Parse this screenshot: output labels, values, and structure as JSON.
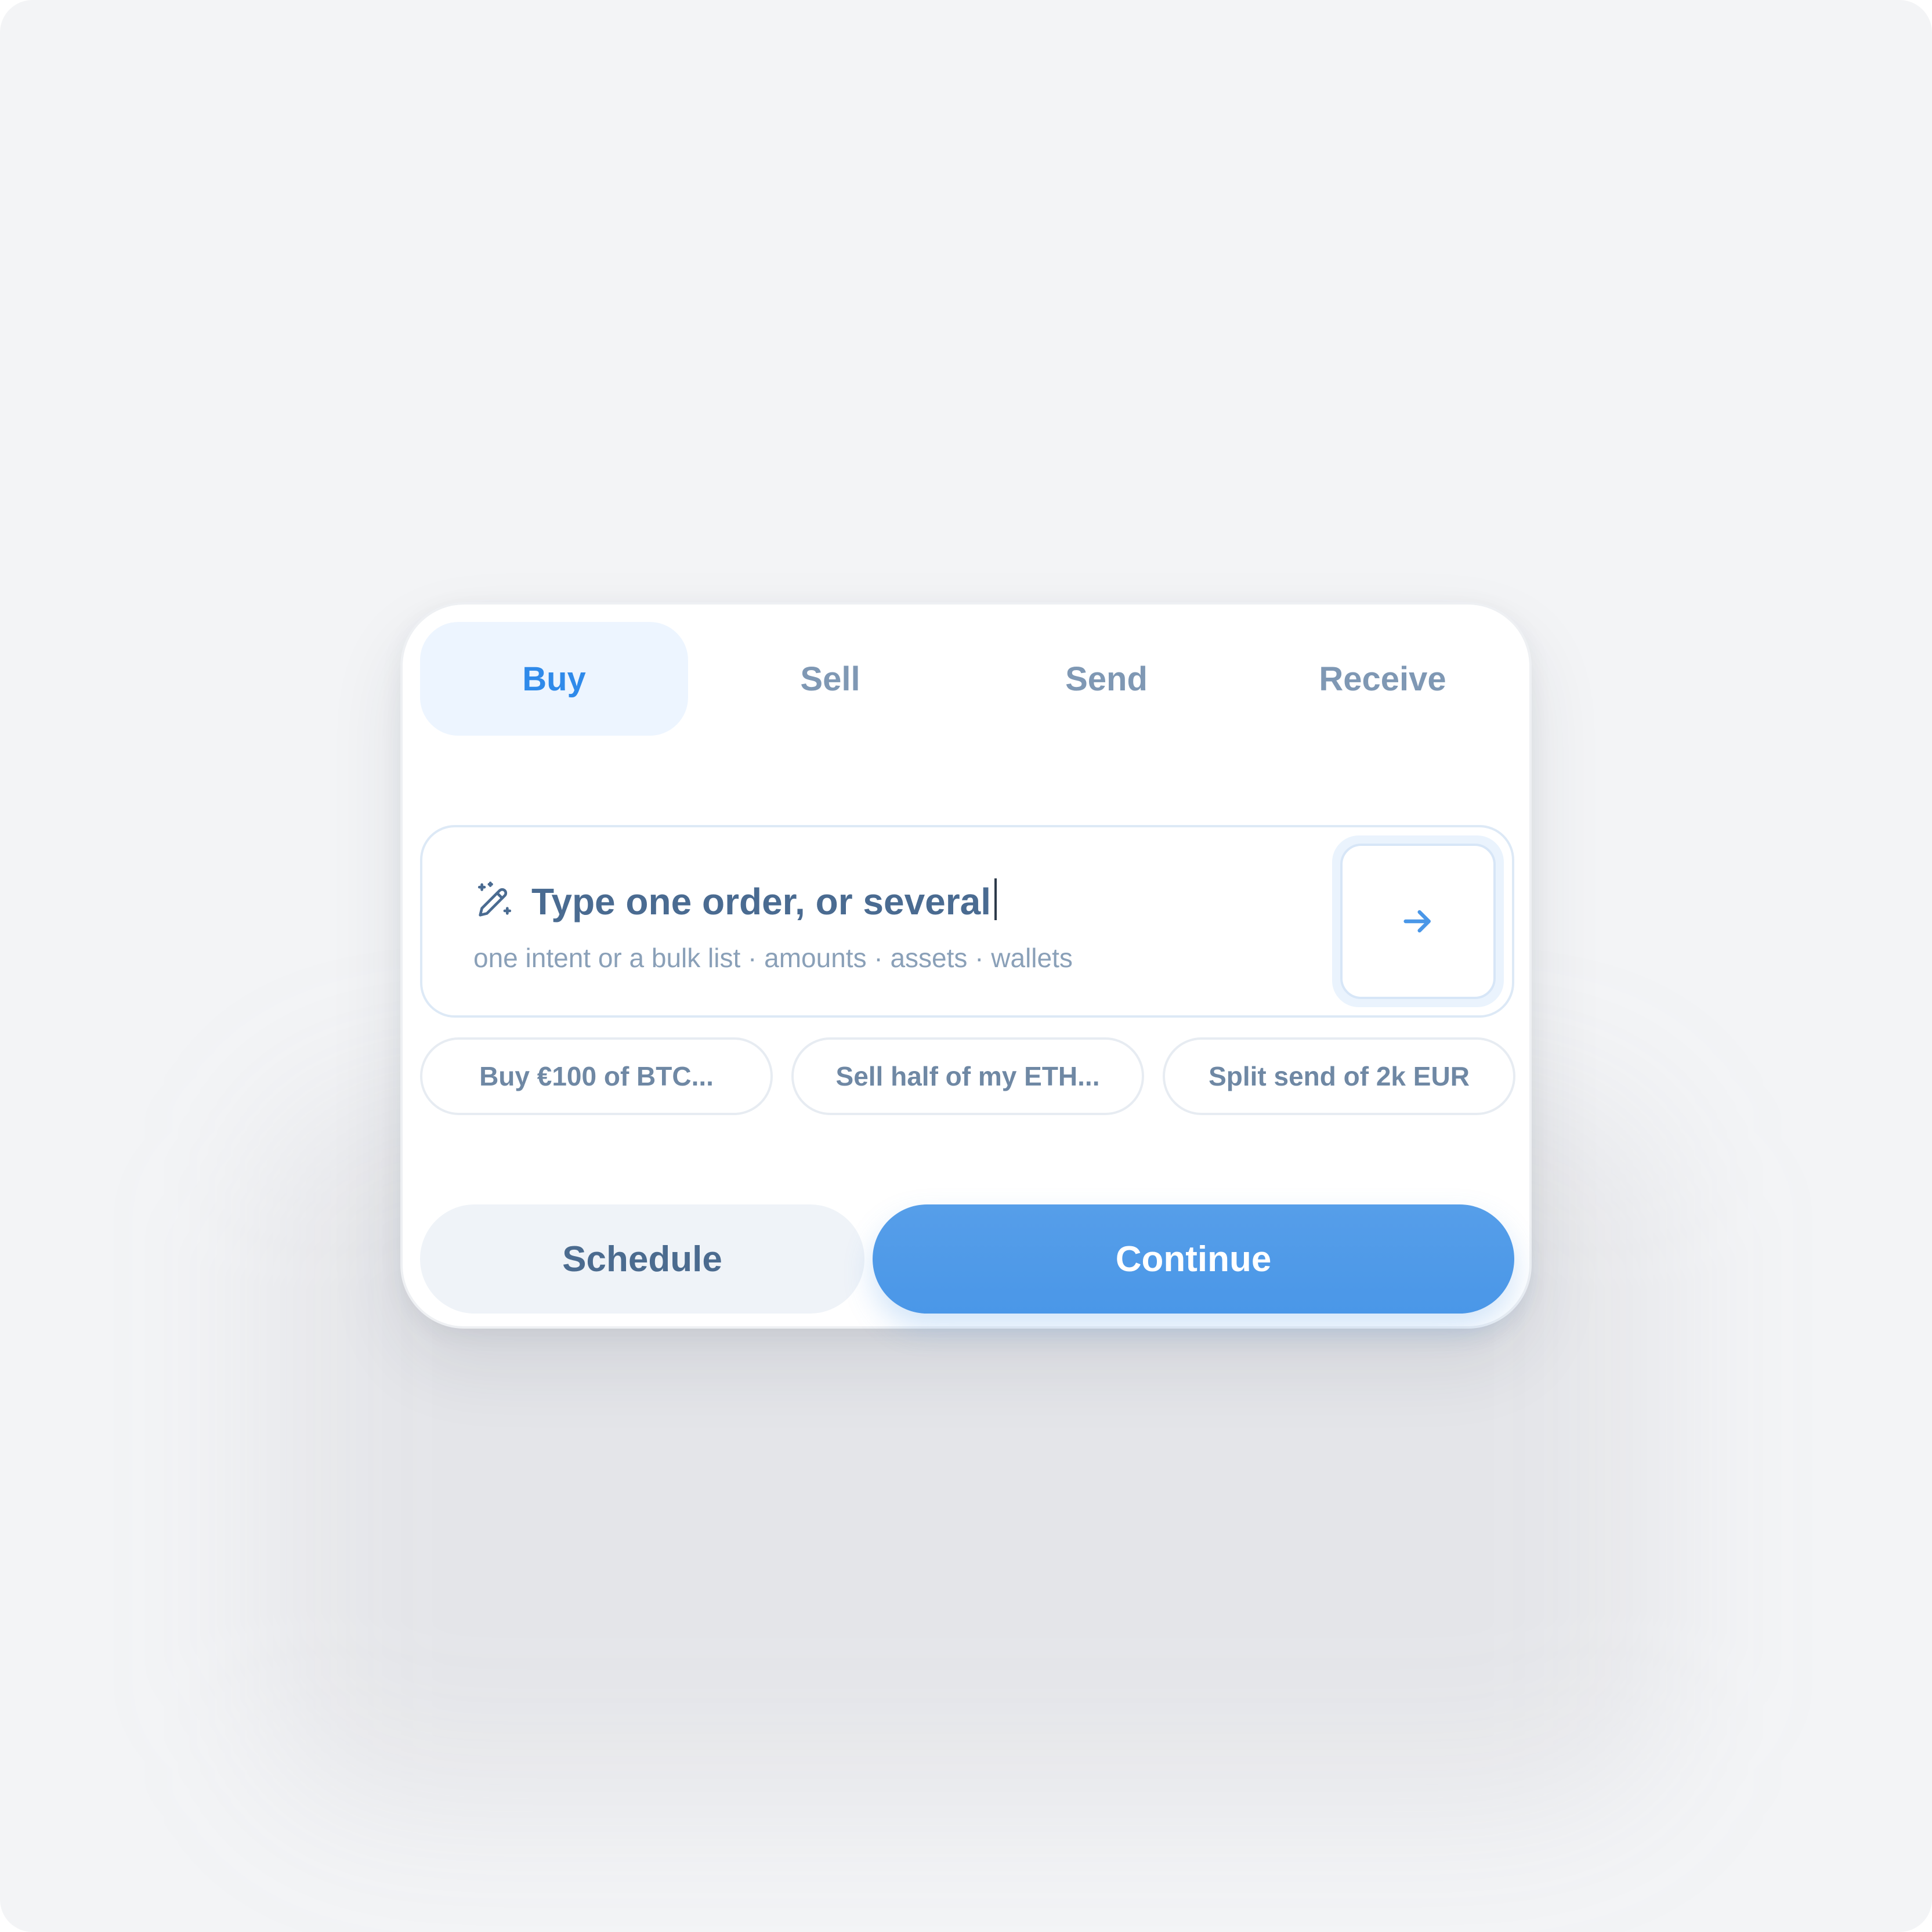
{
  "tabs": [
    {
      "label": "Buy",
      "active": true
    },
    {
      "label": "Sell",
      "active": false
    },
    {
      "label": "Send",
      "active": false
    },
    {
      "label": "Receive",
      "active": false
    }
  ],
  "composer": {
    "title": "Type one order, or several",
    "hint": "one intent or a bulk list · amounts · assets · wallets",
    "leading_icon": "magic-pencil-icon",
    "submit_icon": "arrow-right-icon"
  },
  "suggestions": [
    "Buy €100 of BTC...",
    "Sell half of my ETH...",
    "Split send of 2k EUR"
  ],
  "actions": {
    "schedule_label": "Schedule",
    "continue_label": "Continue"
  },
  "colors": {
    "accent": "#2f8aea",
    "primary_button": "#4f9be9",
    "muted_text": "#7f98b4",
    "background": "#f3f4f6"
  }
}
